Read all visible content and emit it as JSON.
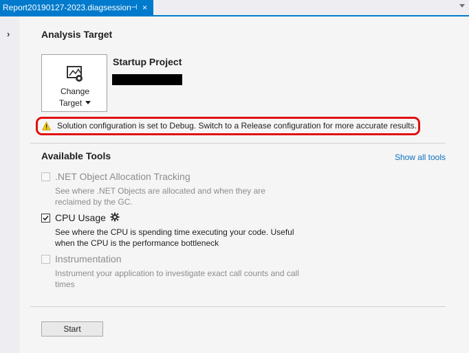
{
  "tab": {
    "title": "Report20190127-2023.diagsession",
    "pin_glyph": "⊣",
    "close_glyph": "×"
  },
  "sidebar": {
    "expand_glyph": "›"
  },
  "analysis_target": {
    "heading": "Analysis Target",
    "change_target_line1": "Change",
    "change_target_line2": "Target",
    "startup_project_label": "Startup Project"
  },
  "warning": {
    "text": "Solution configuration is set to Debug. Switch to a Release configuration for more accurate results.",
    "icon_color": "#f2c811"
  },
  "available_tools": {
    "heading": "Available Tools",
    "show_all_link": "Show all tools",
    "tools": [
      {
        "name": ".NET Object Allocation Tracking",
        "description": "See where .NET Objects are allocated and when they are reclaimed by the GC.",
        "checked": false,
        "enabled": false
      },
      {
        "name": "CPU Usage",
        "description": "See where the CPU is spending time executing your code. Useful when the CPU is the performance bottleneck",
        "checked": true,
        "enabled": true
      },
      {
        "name": "Instrumentation",
        "description": "Instrument your application to investigate exact call counts and call times",
        "checked": false,
        "enabled": false
      }
    ]
  },
  "start_button": {
    "label": "Start"
  },
  "colors": {
    "accent": "#007acc",
    "warning_border": "#e20d0d",
    "link": "#0e70c0"
  }
}
